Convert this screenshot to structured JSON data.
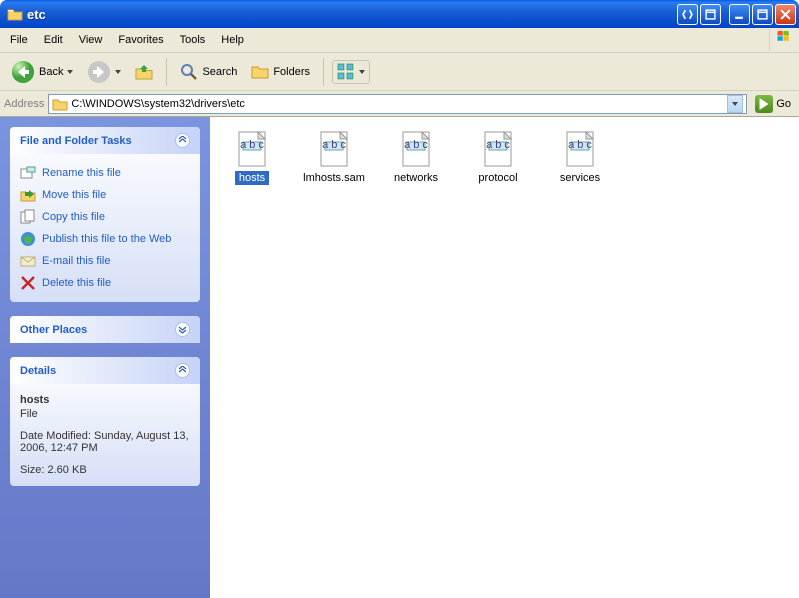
{
  "window": {
    "title": "etc"
  },
  "menu": {
    "file": "File",
    "edit": "Edit",
    "view": "View",
    "favorites": "Favorites",
    "tools": "Tools",
    "help": "Help"
  },
  "toolbar": {
    "back": "Back",
    "search": "Search",
    "folders": "Folders"
  },
  "address": {
    "label": "Address",
    "value": "C:\\WINDOWS\\system32\\drivers\\etc",
    "go": "Go"
  },
  "sidepanels": {
    "fft": {
      "title": "File and Folder Tasks",
      "tasks": {
        "rename": "Rename this file",
        "move": "Move this file",
        "copy": "Copy this file",
        "publish": "Publish this file to the Web",
        "email": "E-mail this file",
        "delete": "Delete this file"
      }
    },
    "other": {
      "title": "Other Places"
    },
    "details": {
      "title": "Details",
      "name": "hosts",
      "type": "File",
      "modified": "Date Modified: Sunday, August 13, 2006, 12:47 PM",
      "size": "Size: 2.60 KB"
    }
  },
  "files": {
    "hosts": "hosts",
    "lmhosts": "lmhosts.sam",
    "networks": "networks",
    "protocol": "protocol",
    "services": "services"
  }
}
